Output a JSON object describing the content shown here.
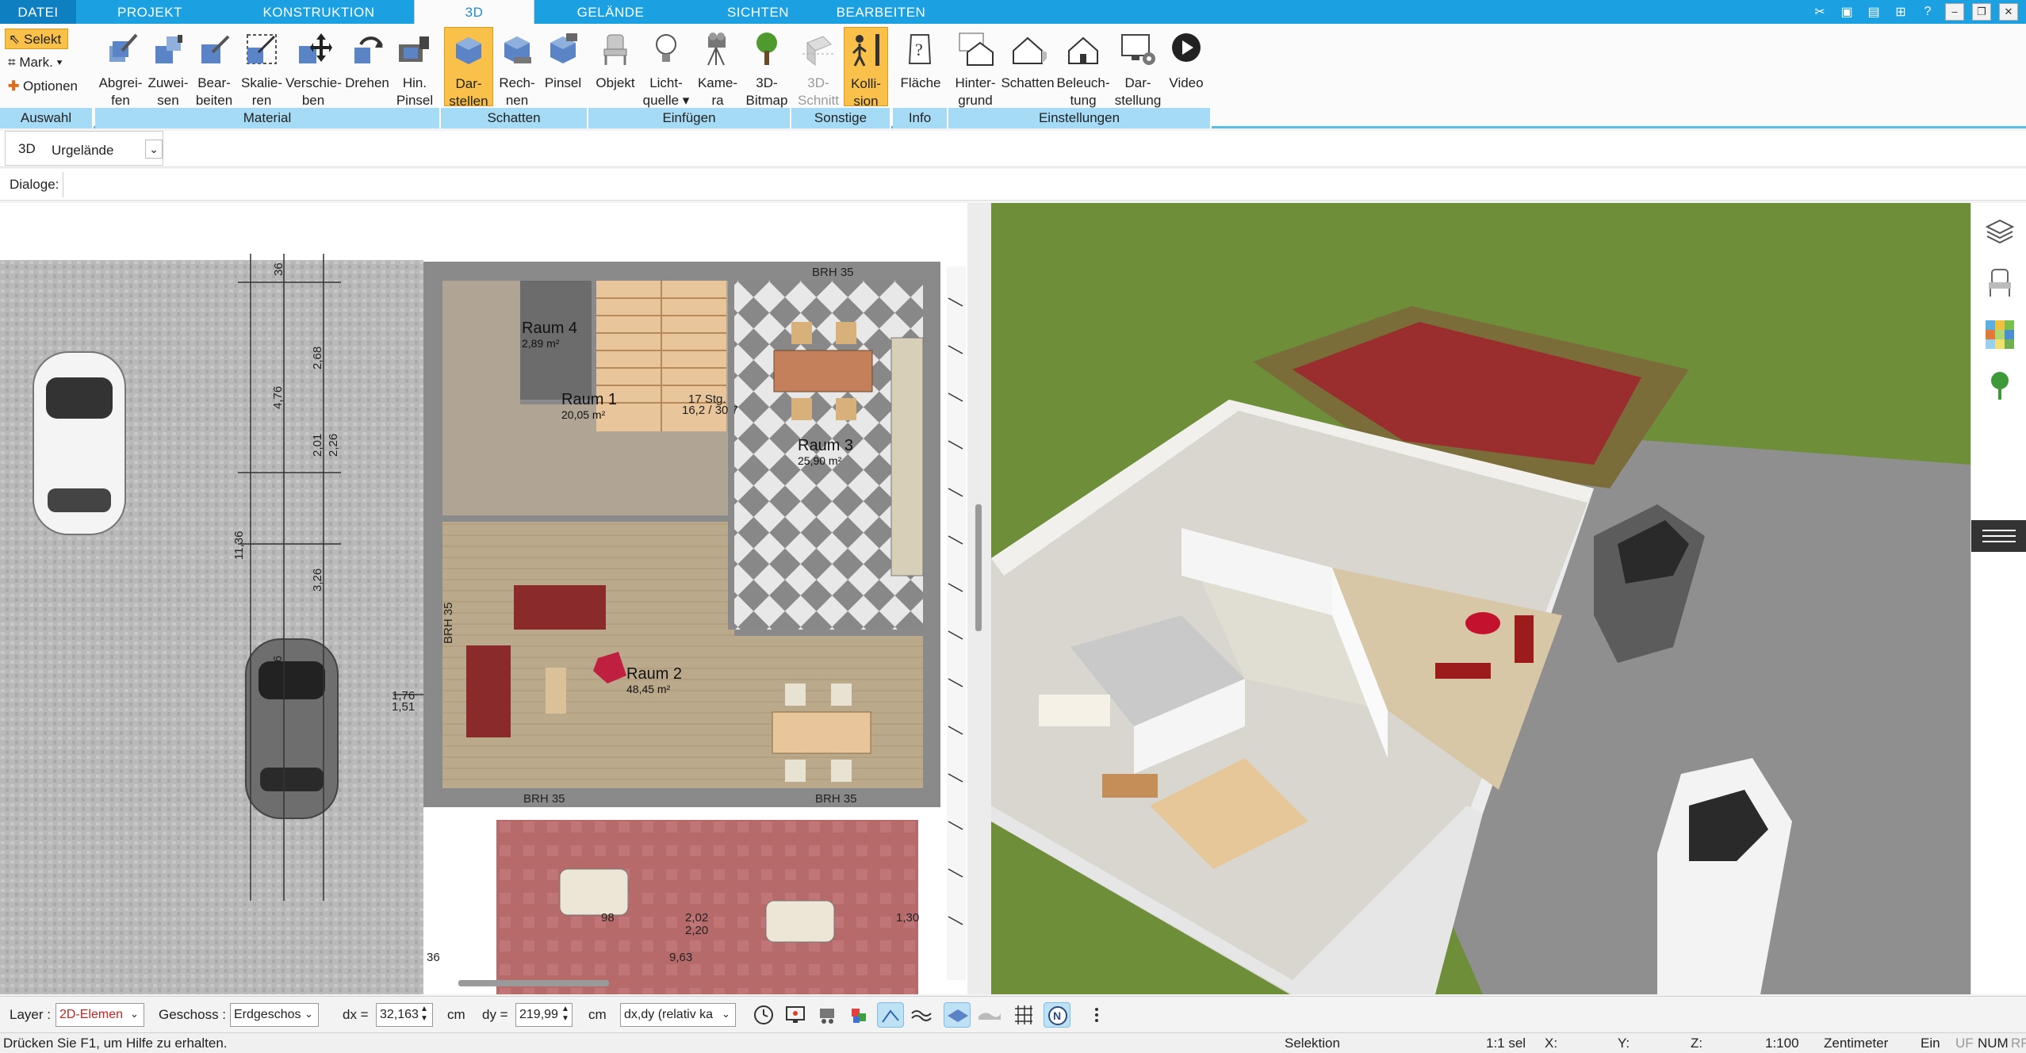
{
  "menu": {
    "tabs": [
      {
        "label": "DATEI"
      },
      {
        "label": "PROJEKT"
      },
      {
        "label": "KONSTRUKTION"
      },
      {
        "label": "3D"
      },
      {
        "label": "GELÄNDE"
      },
      {
        "label": "SICHTEN"
      },
      {
        "label": "BEARBEITEN"
      }
    ],
    "active_tab": "3D"
  },
  "ribbon": {
    "auswahl": {
      "items": [
        "Selekt",
        "Mark.",
        "Optionen"
      ],
      "group": "Auswahl"
    },
    "material": {
      "group": "Material",
      "buttons": [
        {
          "line1": "Abgrei-",
          "line2": "fen"
        },
        {
          "line1": "Zuwei-",
          "line2": "sen"
        },
        {
          "line1": "Bear-",
          "line2": "beiten"
        },
        {
          "line1": "Skalie-",
          "line2": "ren"
        },
        {
          "line1": "Verschie-",
          "line2": "ben"
        },
        {
          "line1": "Drehen",
          "line2": ""
        },
        {
          "line1": "Hin.",
          "line2": "Pinsel"
        }
      ]
    },
    "schatten": {
      "group": "Schatten",
      "buttons": [
        {
          "line1": "Dar-",
          "line2": "stellen"
        },
        {
          "line1": "Rech-",
          "line2": "nen"
        },
        {
          "line1": "Pinsel",
          "line2": ""
        }
      ]
    },
    "einfuegen": {
      "group": "Einfügen",
      "buttons": [
        {
          "line1": "Objekt",
          "line2": ""
        },
        {
          "line1": "Licht-",
          "line2": "quelle"
        },
        {
          "line1": "Kame-",
          "line2": "ra"
        },
        {
          "line1": "3D-",
          "line2": "Bitmap"
        }
      ]
    },
    "sonstige": {
      "group": "Sonstige",
      "buttons": [
        {
          "line1": "3D-",
          "line2": "Schnitt"
        },
        {
          "line1": "Kolli-",
          "line2": "sion"
        }
      ]
    },
    "info": {
      "group": "Info",
      "buttons": [
        {
          "line1": "Fläche",
          "line2": ""
        }
      ]
    },
    "einstellungen": {
      "group": "Einstellungen",
      "buttons": [
        {
          "line1": "Hinter-",
          "line2": "grund"
        },
        {
          "line1": "Schatten",
          "line2": ""
        },
        {
          "line1": "Beleuch-",
          "line2": "tung"
        },
        {
          "line1": "Dar-",
          "line2": "stellung"
        },
        {
          "line1": "Video",
          "line2": ""
        }
      ]
    }
  },
  "toolrow": {
    "mode": "3D",
    "terrain": "Urgelände"
  },
  "dialogrow": {
    "label": "Dialoge:"
  },
  "plan": {
    "rooms": [
      {
        "name": "Raum 4",
        "area": "2,89 m²"
      },
      {
        "name": "Raum 1",
        "area": "20,05 m²"
      },
      {
        "name": "Raum 3",
        "area": "25,90 m²"
      },
      {
        "name": "Raum 2",
        "area": "48,45 m²"
      }
    ],
    "dims": [
      "36",
      "2,68",
      "4,76",
      "2,01",
      "2,26",
      "11,36",
      "3,26",
      "5,76",
      "1,76",
      "1,51",
      "2,01",
      "2,26",
      "88",
      "2,01",
      "17 Stg.",
      "16,2 / 30,7",
      "BRH 35",
      "2,02",
      "2,20",
      "1,30",
      "98",
      "9,63",
      "36",
      "1,76"
    ]
  },
  "bottombar": {
    "layer_label": "Layer :",
    "layer_value": "2D-Elemen",
    "geschoss_label": "Geschoss :",
    "geschoss_value": "Erdgeschos",
    "dx_label": "dx =",
    "dx_value": "32,163",
    "dx_unit": "cm",
    "dy_label": "dy =",
    "dy_value": "219,99",
    "dy_unit": "cm",
    "mode_value": "dx,dy (relativ ka"
  },
  "statusbar": {
    "help": "Drücken Sie F1, um Hilfe zu erhalten.",
    "mode": "Selektion",
    "sel": "1:1 sel",
    "x": "X:",
    "y": "Y:",
    "z": "Z:",
    "scale": "1:100",
    "unit": "Zentimeter",
    "ein": "Ein",
    "uf": "UF",
    "num": "NUM",
    "rf": "RF"
  },
  "colors": {
    "accent": "#1ba1e2",
    "ribbon_group": "#a6dbf5",
    "active_button": "#f9c04a",
    "grass": "#6f8e3a",
    "terrace": "#b85a5a"
  }
}
